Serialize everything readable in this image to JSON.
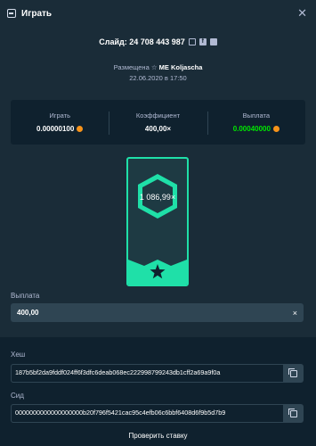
{
  "header": {
    "title": "Играть"
  },
  "slide": {
    "label": "Слайд: 24 708 443 987"
  },
  "placement": {
    "prefix": "Размещена",
    "user": "ME Koljascha",
    "date": "22.06.2020 в 17:50"
  },
  "stats": {
    "bet_label": "Играть",
    "bet_value": "0.00000100",
    "coef_label": "Коэффициент",
    "coef_value": "400,00×",
    "payout_label": "Выплата",
    "payout_value": "0.00040000"
  },
  "card": {
    "multiplier": "1 086,99×"
  },
  "payout_field": {
    "label": "Выплата",
    "value": "400,00"
  },
  "hash": {
    "label": "Хеш",
    "value": "187b5bf2da9fddf024ff6f3dfc6deab068ec222998799243db1cff2a69a9f0a"
  },
  "seed": {
    "label": "Сид",
    "value": "0000000000000000000b20f796f5421cac95c4efb06c6bbf6408d6f9b5d7b9"
  },
  "verify": {
    "label": "Проверить ставку"
  },
  "colors": {
    "accent": "#1fe0a8",
    "payout_green": "#00e701",
    "coin": "#f7931a"
  }
}
